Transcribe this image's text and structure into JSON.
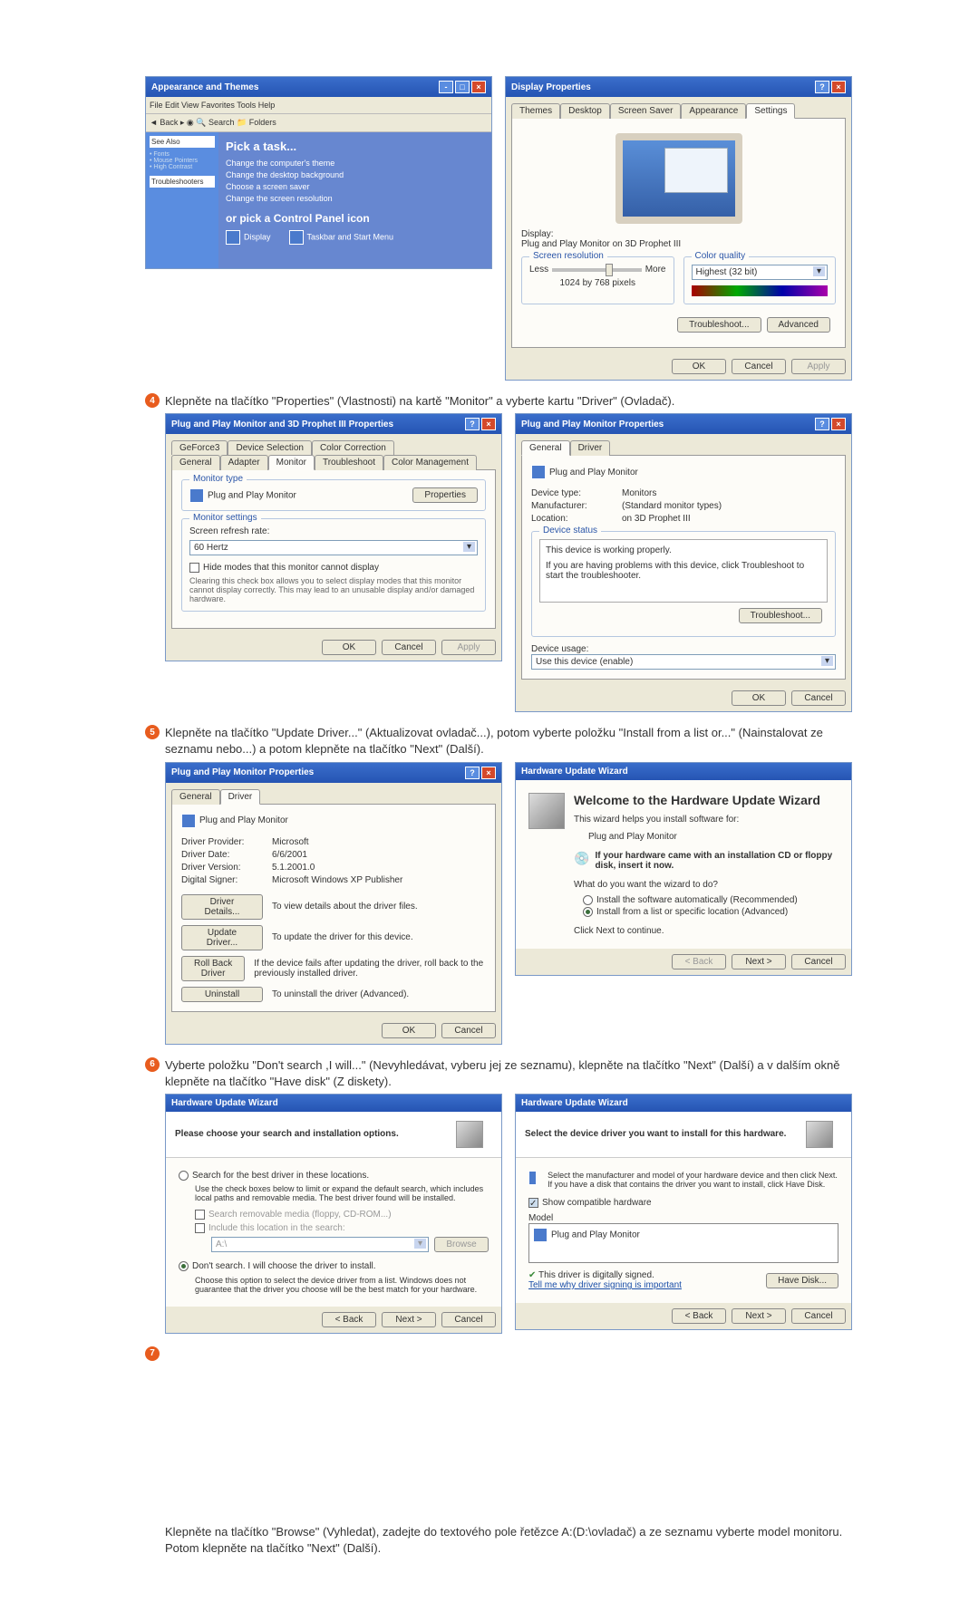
{
  "steps": {
    "s4": "Klepněte na tlačítko \"Properties\" (Vlastnosti) na kartě \"Monitor\" a vyberte kartu \"Driver\" (Ovladač).",
    "s5": "Klepněte na tlačítko \"Update Driver...\" (Aktualizovat ovladač...), potom vyberte položku \"Install from a list or...\" (Nainstalovat ze seznamu nebo...) a potom klepněte na tlačítko \"Next\" (Další).",
    "s6": "Vyberte položku \"Don't search ,I will...\" (Nevyhledávat, vyberu jej ze seznamu), klepněte na tlačítko \"Next\" (Další) a v dalším okně klepněte na tlačítko \"Have disk\" (Z diskety).",
    "footer": "Klepněte na tlačítko \"Browse\" (Vyhledat), zadejte do textového pole řetězce A:(D:\\ovladač) a ze seznamu vyberte model monitoru. Potom klepněte na tlačítko \"Next\" (Další)."
  },
  "explorer": {
    "title": "Appearance and Themes",
    "pick_task": "Pick a task...",
    "task1": "Change the computer's theme",
    "task2": "Change the desktop background",
    "task3": "Choose a screen saver",
    "task4": "Change the screen resolution",
    "or_pick": "or pick a Control Panel icon",
    "icon1": "Display",
    "icon2": "Taskbar and Start Menu",
    "side_see": "See Also",
    "side_trouble": "Troubleshooters"
  },
  "display_props": {
    "title": "Display Properties",
    "tabs": {
      "themes": "Themes",
      "desktop": "Desktop",
      "screensaver": "Screen Saver",
      "appearance": "Appearance",
      "settings": "Settings"
    },
    "display_label": "Display:",
    "display_value": "Plug and Play Monitor on 3D Prophet III",
    "res_label": "Screen resolution",
    "less": "Less",
    "more": "More",
    "res_value": "1024 by 768 pixels",
    "quality_label": "Color quality",
    "quality_value": "Highest (32 bit)",
    "troubleshoot": "Troubleshoot...",
    "advanced": "Advanced",
    "ok": "OK",
    "cancel": "Cancel",
    "apply": "Apply"
  },
  "adv_props": {
    "title": "Plug and Play Monitor and 3D Prophet III Properties",
    "tabs": {
      "geforce": "GeForce3",
      "devsel": "Device Selection",
      "colorcorr": "Color Correction",
      "general": "General",
      "adapter": "Adapter",
      "monitor": "Monitor",
      "troubleshoot": "Troubleshoot",
      "colormgmt": "Color Management"
    },
    "montype_label": "Monitor type",
    "montype_value": "Plug and Play Monitor",
    "properties": "Properties",
    "monset_label": "Monitor settings",
    "refresh_label": "Screen refresh rate:",
    "refresh_value": "60 Hertz",
    "hide_check": "Hide modes that this monitor cannot display",
    "hide_desc": "Clearing this check box allows you to select display modes that this monitor cannot display correctly. This may lead to an unusable display and/or damaged hardware.",
    "ok": "OK",
    "cancel": "Cancel",
    "apply": "Apply"
  },
  "mon_props": {
    "title": "Plug and Play Monitor Properties",
    "tabs": {
      "general": "General",
      "driver": "Driver"
    },
    "name": "Plug and Play Monitor",
    "devtype_l": "Device type:",
    "devtype_v": "Monitors",
    "manuf_l": "Manufacturer:",
    "manuf_v": "(Standard monitor types)",
    "loc_l": "Location:",
    "loc_v": "on 3D Prophet III",
    "status_label": "Device status",
    "status_text": "This device is working properly.",
    "status_help": "If you are having problems with this device, click Troubleshoot to start the troubleshooter.",
    "troubleshoot": "Troubleshoot...",
    "usage_label": "Device usage:",
    "usage_value": "Use this device (enable)",
    "ok": "OK",
    "cancel": "Cancel"
  },
  "driver_tab": {
    "title": "Plug and Play Monitor Properties",
    "name": "Plug and Play Monitor",
    "prov_l": "Driver Provider:",
    "prov_v": "Microsoft",
    "date_l": "Driver Date:",
    "date_v": "6/6/2001",
    "ver_l": "Driver Version:",
    "ver_v": "5.1.2001.0",
    "sign_l": "Digital Signer:",
    "sign_v": "Microsoft Windows XP Publisher",
    "details_btn": "Driver Details...",
    "details_txt": "To view details about the driver files.",
    "update_btn": "Update Driver...",
    "update_txt": "To update the driver for this device.",
    "rollback_btn": "Roll Back Driver",
    "rollback_txt": "If the device fails after updating the driver, roll back to the previously installed driver.",
    "uninstall_btn": "Uninstall",
    "uninstall_txt": "To uninstall the driver (Advanced).",
    "ok": "OK",
    "cancel": "Cancel"
  },
  "wizard1": {
    "title": "Hardware Update Wizard",
    "welcome": "Welcome to the Hardware Update Wizard",
    "helps": "This wizard helps you install software for:",
    "device": "Plug and Play Monitor",
    "cd_hint": "If your hardware came with an installation CD or floppy disk, insert it now.",
    "what": "What do you want the wizard to do?",
    "opt1": "Install the software automatically (Recommended)",
    "opt2": "Install from a list or specific location (Advanced)",
    "click_next": "Click Next to continue.",
    "back": "< Back",
    "next": "Next >",
    "cancel": "Cancel"
  },
  "wizard2": {
    "title": "Hardware Update Wizard",
    "heading": "Please choose your search and installation options.",
    "opt1": "Search for the best driver in these locations.",
    "opt1_desc": "Use the check boxes below to limit or expand the default search, which includes local paths and removable media. The best driver found will be installed.",
    "chk1": "Search removable media (floppy, CD-ROM...)",
    "chk2": "Include this location in the search:",
    "path": "A:\\",
    "browse": "Browse",
    "opt2": "Don't search. I will choose the driver to install.",
    "opt2_desc": "Choose this option to select the device driver from a list. Windows does not guarantee that the driver you choose will be the best match for your hardware.",
    "back": "< Back",
    "next": "Next >",
    "cancel": "Cancel"
  },
  "wizard3": {
    "title": "Hardware Update Wizard",
    "heading": "Select the device driver you want to install for this hardware.",
    "desc": "Select the manufacturer and model of your hardware device and then click Next. If you have a disk that contains the driver you want to install, click Have Disk.",
    "show_compat": "Show compatible hardware",
    "model": "Model",
    "model_item": "Plug and Play Monitor",
    "signed": "This driver is digitally signed.",
    "tell_me": "Tell me why driver signing is important",
    "have_disk": "Have Disk...",
    "back": "< Back",
    "next": "Next >",
    "cancel": "Cancel"
  }
}
